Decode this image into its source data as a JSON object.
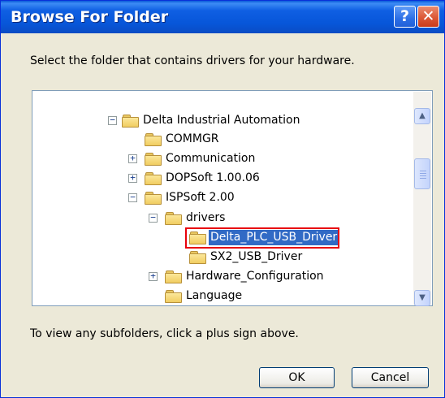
{
  "window": {
    "title": "Browse For Folder",
    "help_label": "?",
    "close_label": "✕"
  },
  "instruction": "Select the folder that contains drivers for your hardware.",
  "tree": {
    "items": [
      {
        "label": "Delta Industrial Automation",
        "expander": "−"
      },
      {
        "label": "COMMGR",
        "expander": ""
      },
      {
        "label": "Communication",
        "expander": "+"
      },
      {
        "label": "DOPSoft 1.00.06",
        "expander": "+"
      },
      {
        "label": "ISPSoft 2.00",
        "expander": "−"
      },
      {
        "label": "drivers",
        "expander": "−"
      },
      {
        "label": "Delta_PLC_USB_Driver",
        "expander": "",
        "selected": true
      },
      {
        "label": "SX2_USB_Driver",
        "expander": ""
      },
      {
        "label": "Hardware_Configuration",
        "expander": "+"
      },
      {
        "label": "Language",
        "expander": ""
      }
    ]
  },
  "scrollbar": {
    "up_arrow": "▲",
    "down_arrow": "▼"
  },
  "hint": "To view any subfolders, click a plus sign above.",
  "buttons": {
    "ok": "OK",
    "cancel": "Cancel"
  }
}
